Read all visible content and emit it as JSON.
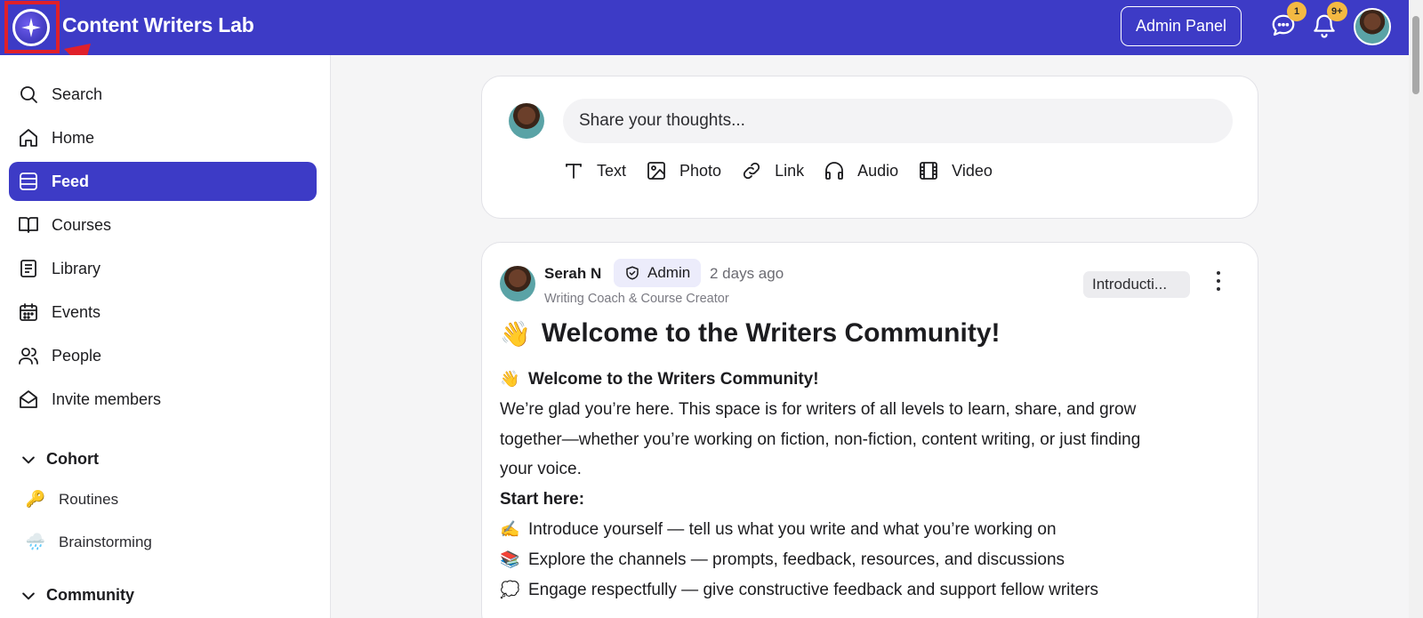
{
  "app": {
    "title": "Content Writers Lab",
    "accent": "#3d3bc6",
    "admin_button": "Admin Panel",
    "messages_badge": "1",
    "notifications_badge": "9+"
  },
  "sidebar": {
    "items": [
      {
        "label": "Search",
        "icon": "search-icon"
      },
      {
        "label": "Home",
        "icon": "home-icon"
      },
      {
        "label": "Feed",
        "icon": "feed-icon",
        "active": true
      },
      {
        "label": "Courses",
        "icon": "book-icon"
      },
      {
        "label": "Library",
        "icon": "library-icon"
      },
      {
        "label": "Events",
        "icon": "calendar-icon"
      },
      {
        "label": "People",
        "icon": "people-icon"
      },
      {
        "label": "Invite members",
        "icon": "envelope-icon"
      }
    ],
    "sections": [
      {
        "label": "Cohort",
        "items": [
          {
            "label": "Routines",
            "icon": "🔑"
          },
          {
            "label": "Brainstorming",
            "icon": "🌧️"
          }
        ]
      },
      {
        "label": "Community",
        "items": []
      }
    ]
  },
  "composer": {
    "placeholder": "Share your thoughts...",
    "actions": [
      {
        "label": "Text",
        "icon": "text-icon"
      },
      {
        "label": "Photo",
        "icon": "image-icon"
      },
      {
        "label": "Link",
        "icon": "link-icon"
      },
      {
        "label": "Audio",
        "icon": "headphones-icon"
      },
      {
        "label": "Video",
        "icon": "film-icon"
      }
    ]
  },
  "post": {
    "author": "Serah N",
    "role": "Admin",
    "time": "2 days ago",
    "author_title": "Writing Coach & Course Creator",
    "channel": "Introducti...",
    "title_emoji": "👋",
    "title": "Welcome to the Writers Community!",
    "body": {
      "heading_emoji": "👋",
      "heading": "Welcome to the Writers Community!",
      "line1": "We’re glad you’re here. This space is for writers of all levels to learn, share, and grow",
      "line2": "together—whether you’re working on fiction, non-fiction, content writing, or just finding",
      "line3": "your voice.",
      "start_here": "Start here:",
      "bullets": [
        {
          "emoji": "✍️",
          "text": "Introduce yourself — tell us what you write and what you’re working on"
        },
        {
          "emoji": "📚",
          "text": "Explore the channels — prompts, feedback, resources, and discussions"
        },
        {
          "emoji": "💭",
          "text": "Engage respectfully — give constructive feedback and support fellow writers"
        }
      ]
    }
  }
}
